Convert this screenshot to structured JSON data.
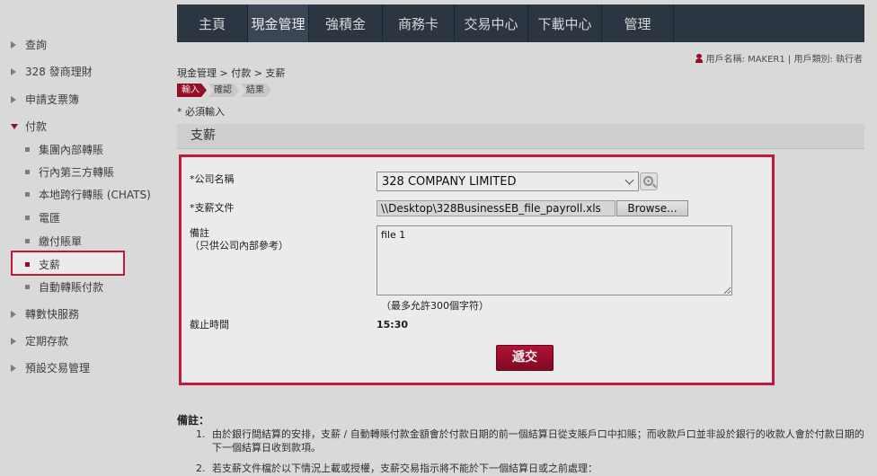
{
  "sidebar": {
    "items": [
      {
        "label": "查詢"
      },
      {
        "label": "328 發商理財"
      },
      {
        "label": "申請支票簿"
      },
      {
        "label": "付款"
      },
      {
        "label": "轉數快服務"
      },
      {
        "label": "定期存款"
      },
      {
        "label": "預設交易管理"
      }
    ],
    "sub_items": [
      {
        "label": "集團內部轉賬"
      },
      {
        "label": "行內第三方轉賬"
      },
      {
        "label": "本地跨行轉賬 (CHATS)"
      },
      {
        "label": "電匯"
      },
      {
        "label": "繳付賬單"
      },
      {
        "label": "支薪"
      },
      {
        "label": "自動轉賬付款"
      }
    ]
  },
  "nav": {
    "tabs": [
      {
        "label": "主頁"
      },
      {
        "label": "現金管理"
      },
      {
        "label": "強積金"
      },
      {
        "label": "商務卡"
      },
      {
        "label": "交易中心"
      },
      {
        "label": "下載中心"
      },
      {
        "label": "管理"
      }
    ]
  },
  "user": {
    "info": "用戶名稱: MAKER1 | 用戶類別: 執行者"
  },
  "breadcrumb": "現金管理 > 付款 > 支薪",
  "steps": [
    {
      "label": "輸入"
    },
    {
      "label": "確認"
    },
    {
      "label": "結果"
    }
  ],
  "required_note": "* 必須輸入",
  "section_title": "支薪",
  "form": {
    "company_label": "*公司名稱",
    "company_value": "328 COMPANY LIMITED",
    "file_label": "*支薪文件",
    "file_path": "\\\\Desktop\\328BusinessEB_file_payroll.xls",
    "browse_label": "Browse...",
    "remark_label": "備註",
    "remark_sublabel": "（只供公司內部參考）",
    "remark_value": "file 1",
    "char_limit": "（最多允許300個字符）",
    "cutoff_label": "截止時間",
    "cutoff_value": "15:30",
    "submit_label": "遞交"
  },
  "notes": {
    "title": "備註：",
    "items": [
      {
        "num": "1.",
        "text": "由於銀行間結算的安排，支薪 / 自動轉賬付款金額會於付款日期的前一個結算日從支賬戶口中扣賬；而收款戶口並非設於銀行的收款人會於付款日期的下一個結算日收到款項。"
      },
      {
        "num": "2.",
        "text": "若支薪文件檔於以下情況上載或授權，支薪交易指示將不能於下一個結算日或之前處理："
      }
    ]
  },
  "colors": {
    "accent": "#a0102a",
    "highlight_border": "#d21c44",
    "nav_bg": "#2f3b48"
  }
}
